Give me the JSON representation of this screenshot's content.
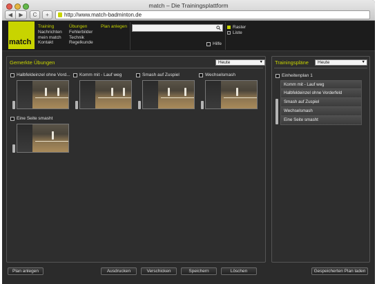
{
  "window": {
    "title": "match – Die Trainingsplattform"
  },
  "browser": {
    "url": "http://www.match-badminton.de",
    "back_glyph": "◀",
    "forward_glyph": "▶",
    "reload_glyph": "C",
    "add_tab_glyph": "+"
  },
  "brand": {
    "logo": "match",
    "accent": "#c8d400"
  },
  "nav": {
    "col1": [
      "Training",
      "Nachrichten",
      "mein match",
      "Kontakt"
    ],
    "col2": [
      "Übungen",
      "Fehlerbilder",
      "Technik",
      "Regelkunde"
    ],
    "col3": [
      "Plan anlegen"
    ]
  },
  "search": {
    "placeholder": "",
    "icon": "search-icon"
  },
  "help": {
    "label": "Hilfe"
  },
  "view": {
    "raster": "Raster",
    "liste": "Liste",
    "selected": "Raster"
  },
  "left_panel": {
    "title": "Gemerkte Übungen",
    "filter": "Heute",
    "exercises": [
      {
        "label": "Halbfeldeinzel ohne Vord..."
      },
      {
        "label": "Komm mit - Lauf weg"
      },
      {
        "label": "Smash auf Zuspiel"
      },
      {
        "label": "Wechselsmash"
      },
      {
        "label": "Eine Seite smasht"
      }
    ]
  },
  "right_panel": {
    "title": "Trainingspläne",
    "filter": "Heute",
    "plan_name": "Einheitenplan 1",
    "items": [
      "Komm mit - Lauf weg",
      "Halbfeldeinzel ohne Vorderfeld",
      "Smash auf Zuspiel",
      "Wechselsmash",
      "Eine Seite smasht"
    ]
  },
  "buttons": {
    "plan_anlegen": "Plan anlegen",
    "ausdrucken": "Ausdrucken",
    "verschicken": "Verschicken",
    "speichern": "Speichern",
    "loeschen": "Löschen",
    "gespeicherten_plan_laden": "Gespeicherten Plan laden"
  }
}
